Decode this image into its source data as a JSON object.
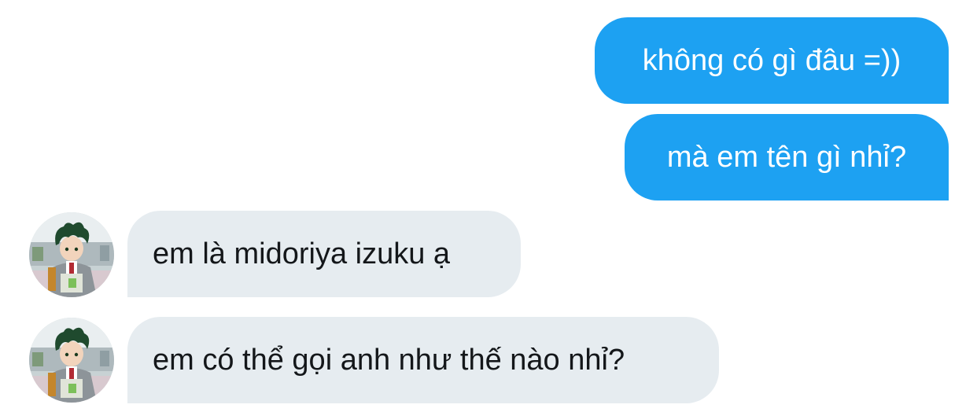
{
  "messages": [
    {
      "sender": "me",
      "text": "không có gì đâu =))"
    },
    {
      "sender": "me",
      "text": "mà em tên gì nhỉ?"
    },
    {
      "sender": "other",
      "text": "em là midoriya izuku ạ"
    },
    {
      "sender": "other",
      "text": "em có thể gọi anh như thế nào nhỉ?"
    }
  ],
  "colors": {
    "sent_bubble": "#1da1f2",
    "sent_text": "#ffffff",
    "received_bubble": "#e6ecf0",
    "received_text": "#14171a"
  },
  "avatar": {
    "icon": "anime-character-avatar"
  }
}
